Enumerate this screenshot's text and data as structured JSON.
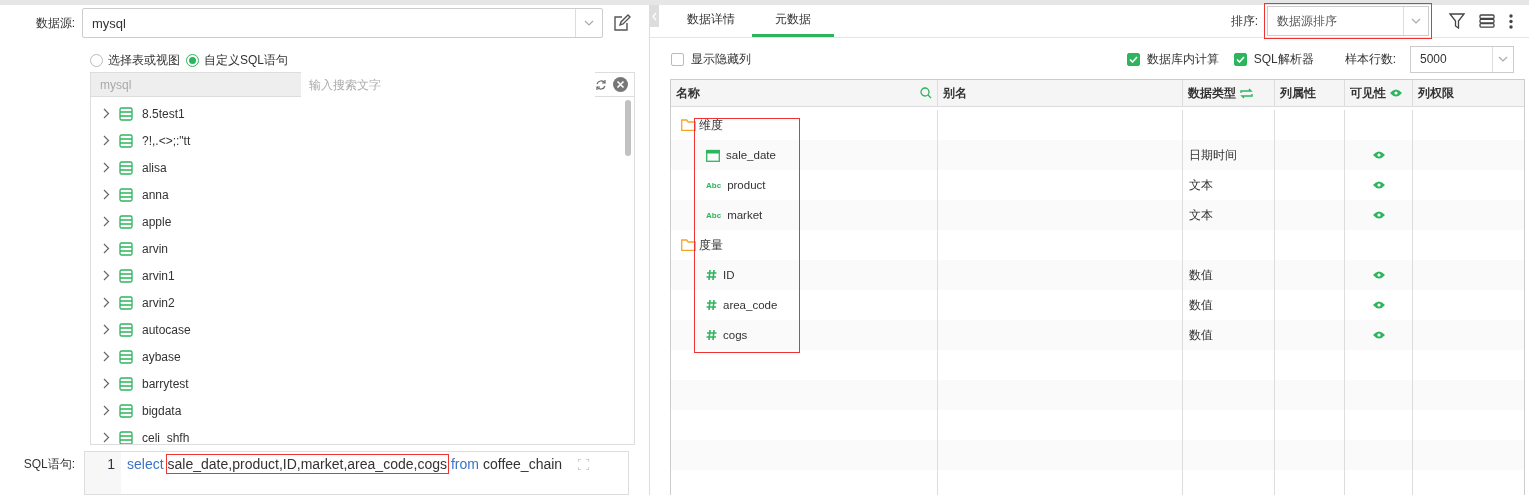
{
  "left": {
    "datasource": {
      "label": "数据源:",
      "value": "mysql"
    },
    "modes": [
      {
        "label": "选择表或视图",
        "selected": false
      },
      {
        "label": "自定义SQL语句",
        "selected": true
      }
    ],
    "browser": {
      "source": "mysql",
      "search_placeholder": "输入搜索文字",
      "items": [
        "8.5test1",
        "?!,.<>;:\"tt",
        "alisa",
        "anna",
        "apple",
        "arvin",
        "arvin1",
        "arvin2",
        "autocase",
        "aybase",
        "barrytest",
        "bigdata",
        "celi_shfh"
      ]
    },
    "sql": {
      "label": "SQL语句:",
      "line_number": "1",
      "keyword_select": "select",
      "columns": "sale_date,product,ID,market,area_code,cogs",
      "columns_highlighted": true,
      "keyword_from": "from",
      "table": "coffee_chain"
    }
  },
  "right": {
    "tabs": [
      {
        "label": "数据详情",
        "selected": false
      },
      {
        "label": "元数据",
        "selected": true
      }
    ],
    "sort": {
      "label": "排序:",
      "value": "数据源排序",
      "highlighted": true
    },
    "options": [
      {
        "label": "显示隐藏列",
        "checked": false
      },
      {
        "label": "数据库内计算",
        "checked": true
      },
      {
        "label": "SQL解析器",
        "checked": true
      }
    ],
    "sample_rows": {
      "label": "样本行数:",
      "value": "5000"
    },
    "table": {
      "columns": [
        "名称",
        "别名",
        "数据类型",
        "列属性",
        "可见性",
        "列权限"
      ],
      "name_column_highlighted": true,
      "groups": [
        {
          "name": "维度",
          "children": [
            {
              "name": "sale_date",
              "kind": "date",
              "type": "日期时间",
              "visible": true
            },
            {
              "name": "product",
              "kind": "text",
              "badge": "Abc",
              "type": "文本",
              "visible": true
            },
            {
              "name": "market",
              "kind": "text",
              "badge": "Abc",
              "type": "文本",
              "visible": true
            }
          ]
        },
        {
          "name": "度量",
          "children": [
            {
              "name": "ID",
              "kind": "number",
              "type": "数值",
              "visible": true
            },
            {
              "name": "area_code",
              "kind": "number",
              "type": "数值",
              "visible": true
            },
            {
              "name": "cogs",
              "kind": "number",
              "type": "数值",
              "visible": true
            }
          ]
        }
      ]
    }
  }
}
